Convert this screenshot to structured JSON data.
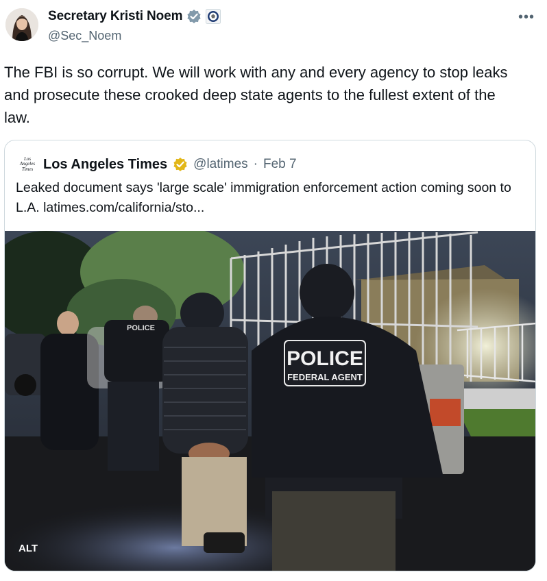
{
  "author": {
    "name": "Secretary Kristi Noem",
    "handle": "@Sec_Noem",
    "avatar_icon": "profile-photo-icon",
    "verified_icon": "gray-verified-badge-icon",
    "affiliation_icon": "dhs-seal-icon"
  },
  "menu": {
    "more_label": "•••"
  },
  "tweet": {
    "text": "The FBI is so corrupt. We will work with any and every agency to stop leaks and prosecute these crooked deep state agents to the fullest extent of the law."
  },
  "quote": {
    "logo_text": "Los Angeles Times",
    "name": "Los Angeles Times",
    "handle": "@latimes",
    "separator": "·",
    "date": "Feb 7",
    "verified_icon": "gold-verified-badge-icon",
    "text": "Leaked document says 'large scale' immigration enforcement action coming soon to L.A. latimes.com/california/sto...",
    "image": {
      "alt_label": "ALT",
      "vest_text_1": "POLICE",
      "vest_text_2": "FEDERAL AGENT",
      "back_vest_text": "POLICE"
    }
  },
  "colors": {
    "text": "#0f1419",
    "secondary": "#536471",
    "border": "#cfd9de",
    "gold": "#e2b719",
    "gray_badge": "#829aab"
  }
}
